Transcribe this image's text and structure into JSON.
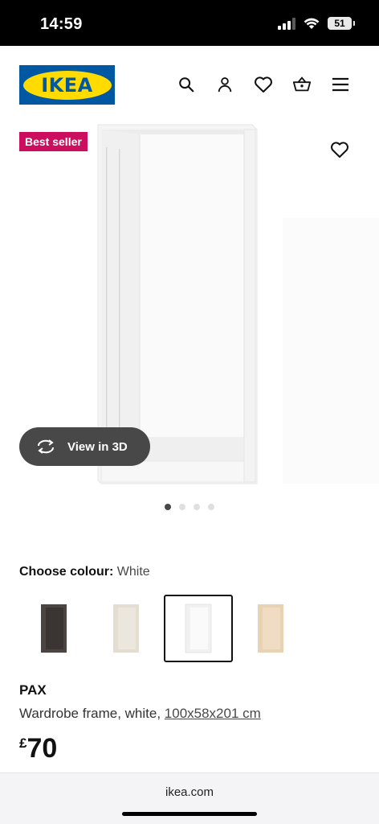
{
  "status_bar": {
    "time": "14:59",
    "battery": "51"
  },
  "header": {
    "logo_text": "IKEA",
    "icons": [
      "search-icon",
      "account-icon",
      "heart-icon",
      "basket-icon",
      "menu-icon"
    ]
  },
  "product": {
    "badge": "Best seller",
    "view3d_label": "View in 3D",
    "image_count": 4,
    "active_image": 1,
    "colour_label": "Choose colour:",
    "colour_value": "White",
    "swatches": [
      {
        "color": "#4a4543",
        "selected": false
      },
      {
        "color": "#e4ded2",
        "selected": false
      },
      {
        "color": "#f7f7f7",
        "selected": true
      },
      {
        "color": "#e8d2b4",
        "selected": false
      }
    ],
    "name": "PAX",
    "description": "Wardrobe frame, white, ",
    "dimensions": "100x58x201 cm",
    "currency": "£",
    "price": "70"
  },
  "browser": {
    "url": "ikea.com"
  },
  "colors": {
    "ikea_blue": "#0058a3",
    "ikea_yellow": "#ffdb00",
    "badge_red": "#cc0e5e"
  }
}
